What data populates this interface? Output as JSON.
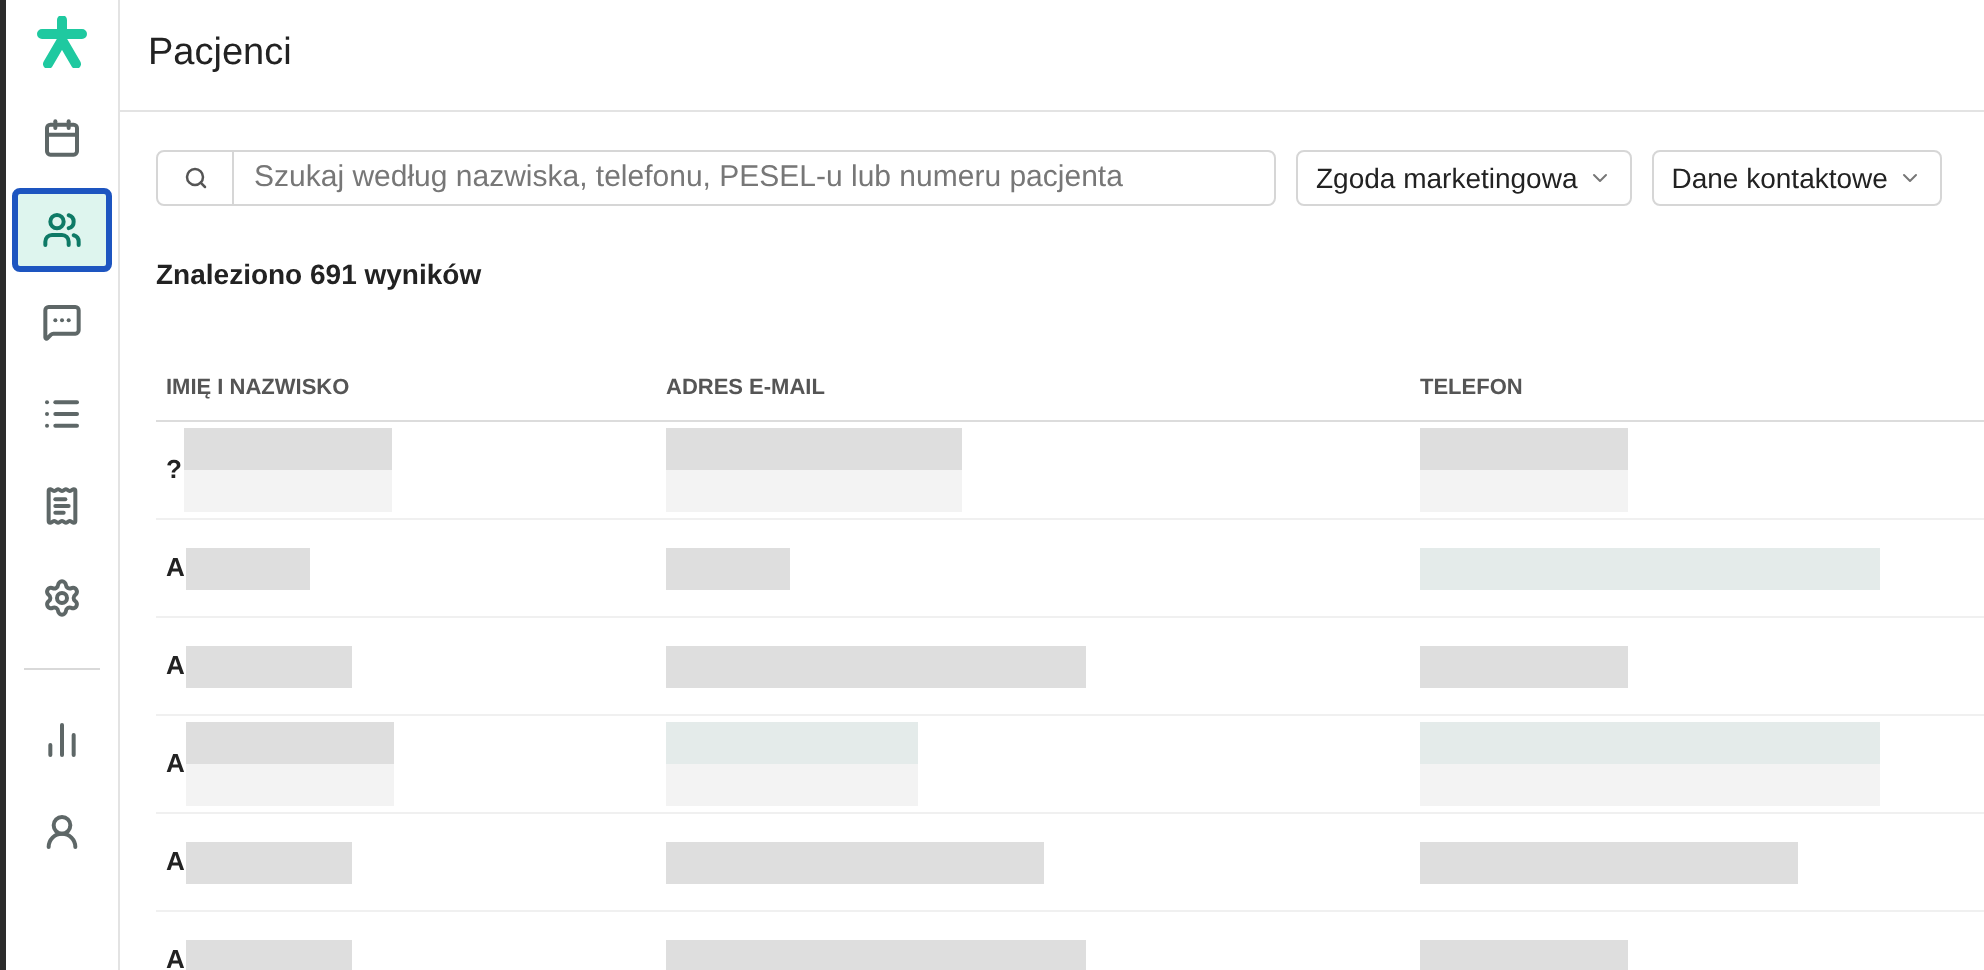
{
  "sidebar": {
    "items": [
      {
        "kind": "calendar",
        "selected": false
      },
      {
        "kind": "patients",
        "selected": true
      },
      {
        "kind": "messages",
        "selected": false
      },
      {
        "kind": "list",
        "selected": false
      },
      {
        "kind": "document",
        "selected": false
      },
      {
        "kind": "settings",
        "selected": false
      },
      {
        "kind": "divider"
      },
      {
        "kind": "stats",
        "selected": false
      },
      {
        "kind": "doctor",
        "selected": false
      }
    ]
  },
  "header": {
    "title": "Pacjenci"
  },
  "search": {
    "placeholder": "Szukaj według nazwiska, telefonu, PESEL-u lub numeru pacjenta"
  },
  "filters": [
    {
      "label": "Zgoda marketingowa"
    },
    {
      "label": "Dane kontaktowe"
    }
  ],
  "results_count": "Znaleziono 691 wyników",
  "table": {
    "columns": [
      "IMIĘ I NAZWISKO",
      "ADRES E-MAIL",
      "TELEFON"
    ],
    "rows": [
      {
        "name": "?"
      },
      {
        "name": "A"
      },
      {
        "name": "A"
      },
      {
        "name": "A"
      },
      {
        "name": "A"
      },
      {
        "name": "A"
      }
    ]
  }
}
